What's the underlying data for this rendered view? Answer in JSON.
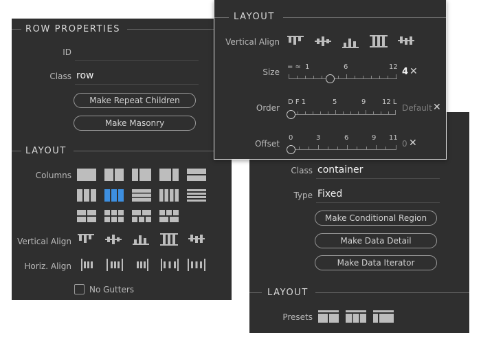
{
  "row_panel": {
    "title": "ROW PROPERTIES",
    "id_label": "ID",
    "id_value": "",
    "class_label": "Class",
    "class_value": "row",
    "make_repeat_children": "Make Repeat Children",
    "make_masonry": "Make Masonry"
  },
  "row_layout": {
    "title": "LAYOUT",
    "columns_label": "Columns",
    "selected_column_preset": 7,
    "vertical_align_label": "Vertical Align",
    "horiz_align_label": "Horiz. Align",
    "no_gutters_label": "No Gutters",
    "no_gutters_checked": false
  },
  "container_panel": {
    "class_label": "Class",
    "class_value": "container",
    "type_label": "Type",
    "type_value": "Fixed",
    "make_conditional_region": "Make Conditional Region",
    "make_data_detail": "Make Data Detail",
    "make_data_iterator": "Make Data Iterator",
    "layout_title": "LAYOUT",
    "presets_label": "Presets"
  },
  "popup": {
    "title": "LAYOUT",
    "vertical_align_label": "Vertical Align",
    "size_label": "Size",
    "size_ticks": [
      "= ≈",
      "1",
      "6",
      "12"
    ],
    "size_value": "4",
    "order_label": "Order",
    "order_ticks": [
      "D F 1",
      "5",
      "9",
      "12 L"
    ],
    "order_value": "Default",
    "offset_label": "Offset",
    "offset_ticks": [
      "0",
      "3",
      "6",
      "9",
      "11"
    ],
    "offset_value": "0",
    "clear_symbol": "✕"
  },
  "colors": {
    "panel_bg": "#2f2f2f",
    "selected_icon": "#3d8fe0",
    "icon_grey": "#bdbdbd"
  }
}
